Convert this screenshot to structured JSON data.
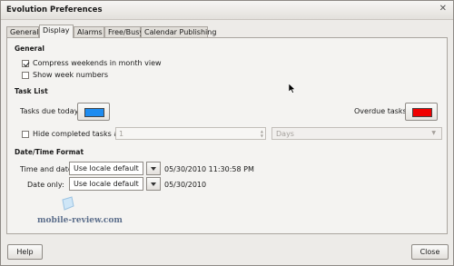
{
  "window": {
    "title": "Evolution Preferences",
    "close_glyph": "✕"
  },
  "tabs": [
    "General",
    "Display",
    "Alarms",
    "Free/Busy",
    "Calendar Publishing"
  ],
  "general": {
    "heading": "General",
    "compress_weekends": {
      "label": "Compress weekends in month view",
      "checked": true
    },
    "show_week_numbers": {
      "label": "Show week numbers",
      "checked": false
    }
  },
  "task_list": {
    "heading": "Task List",
    "due_today_label": "Tasks due today:",
    "due_today_color": "#1e8cf0",
    "overdue_label": "Overdue tasks:",
    "overdue_color": "#f00000",
    "hide_completed": {
      "label": "Hide completed tasks after",
      "checked": false
    },
    "hide_after_value": "1",
    "hide_after_unit": "Days"
  },
  "datetime": {
    "heading": "Date/Time Format",
    "time_and_date_label": "Time and date:",
    "time_and_date_format": "Use locale default",
    "time_and_date_sample": "05/30/2010 11:30:58 PM",
    "date_only_label": "Date only:",
    "date_only_format": "Use locale default",
    "date_only_sample": "05/30/2010"
  },
  "watermark": {
    "text": "mobile-review.com"
  },
  "buttons": {
    "help": "Help",
    "close": "Close"
  }
}
